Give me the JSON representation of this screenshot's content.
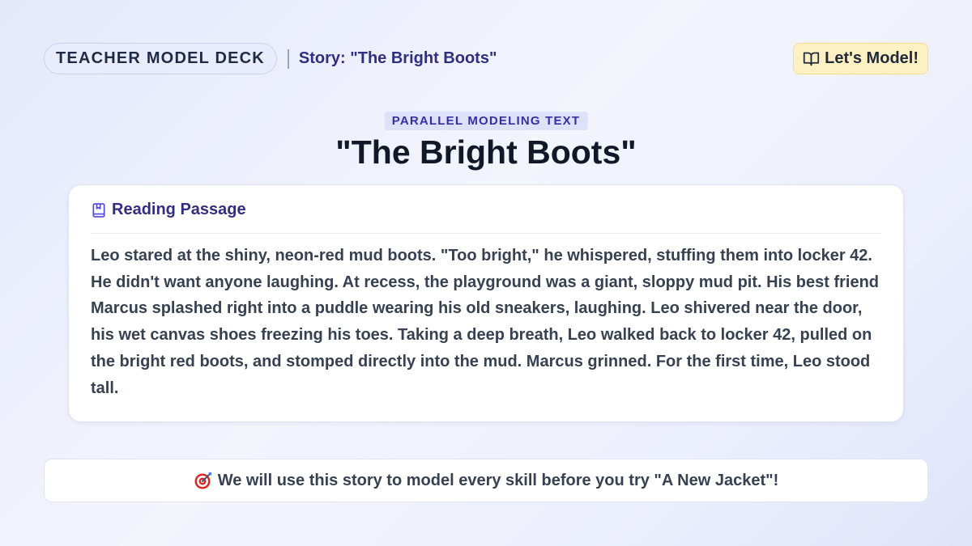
{
  "header": {
    "deck_label": "TEACHER MODEL DECK",
    "story_label": "Story: \"The Bright Boots\"",
    "action_button": {
      "icon": "open-book-icon",
      "label": "Let's Model!"
    }
  },
  "hero": {
    "tag": "PARALLEL MODELING TEXT",
    "title": "\"The Bright Boots\""
  },
  "passage_card": {
    "icon": "bookmark-book-icon",
    "heading": "Reading Passage",
    "text": "Leo stared at the shiny, neon-red mud boots. \"Too bright,\" he whispered, stuffing them into locker 42. He didn't want anyone laughing. At recess, the playground was a giant, sloppy mud pit. His best friend Marcus splashed right into a puddle wearing his old sneakers, laughing. Leo shivered near the door, his wet canvas shoes freezing his toes. Taking a deep breath, Leo walked back to locker 42, pulled on the bright red boots, and stomped directly into the mud. Marcus grinned. For the first time, Leo stood tall."
  },
  "banner": {
    "icon": "target-dart-icon",
    "text": "We will use this story to model every skill before you try \"A New Jacket\"!"
  },
  "colors": {
    "accent_indigo": "#312e81",
    "button_yellow": "#fdf1c4",
    "tag_bg": "#dde2fa"
  }
}
